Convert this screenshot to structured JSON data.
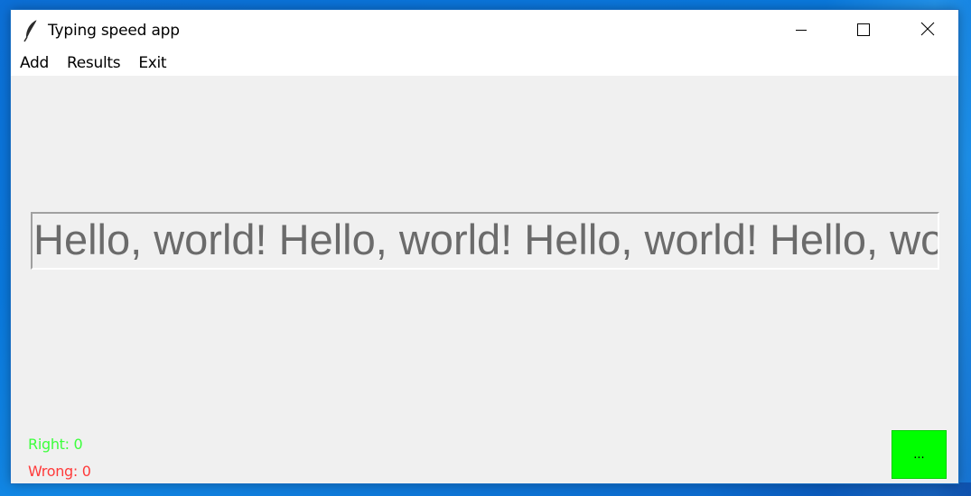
{
  "window": {
    "title": "Typing speed app",
    "app_icon": "feather-icon",
    "controls": {
      "minimize_icon": "minimize-icon",
      "maximize_icon": "maximize-icon",
      "close_icon": "close-icon"
    }
  },
  "menubar": {
    "items": [
      {
        "label": "Add"
      },
      {
        "label": "Results"
      },
      {
        "label": "Exit"
      }
    ]
  },
  "main": {
    "display_text": "Hello, world! Hello, world! Hello, world! Hello, world! Hello, world!",
    "right_label": "Right: 0",
    "wrong_label": "Wrong: 0",
    "button_label": "..."
  },
  "colors": {
    "right": "#3cff3c",
    "wrong": "#ff3a3a",
    "button": "#00ff00",
    "client_bg": "#f0f0f0",
    "desktop": "#0a78dc"
  }
}
